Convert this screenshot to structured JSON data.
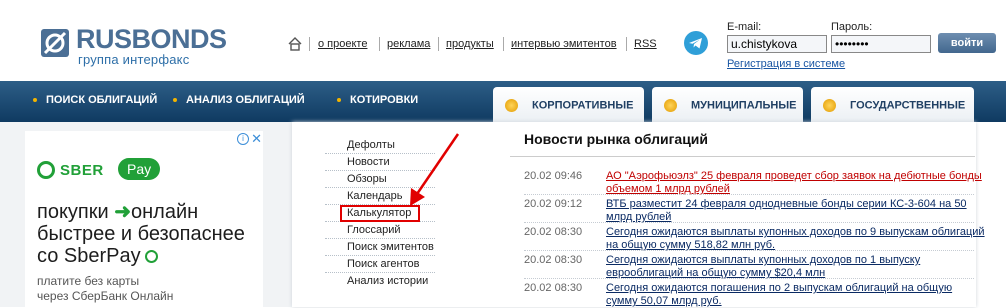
{
  "logo": {
    "brand": "RUSBONDS",
    "subtitle": "группа интерфакс"
  },
  "topnav": {
    "items": [
      "о проекте",
      "реклама",
      "продукты",
      "интервью эмитентов",
      "RSS"
    ]
  },
  "login": {
    "email_label": "E-mail:",
    "email_value": "u.chistykova",
    "password_label": "Пароль:",
    "password_value": "••••••••",
    "submit_label": "войти",
    "register_link": "Регистрация в системе"
  },
  "mainnav": {
    "items": [
      "ПОИСК ОБЛИГАЦИЙ",
      "АНАЛИЗ ОБЛИГАЦИЙ",
      "КОТИРОВКИ"
    ]
  },
  "tabs": [
    "КОРПОРАТИВНЫЕ",
    "МУНИЦИПАЛЬНЫЕ",
    "ГОСУДАРСТВЕННЫЕ"
  ],
  "ad": {
    "info_icon": "i",
    "close_icon": "✕",
    "brand": "SBER",
    "pay": "Pay",
    "headline_1": "покупки",
    "arrow": "➜",
    "headline_2": "онлайн",
    "headline_3": "быстрее и безопаснее",
    "headline_4": "со SberPay",
    "small_1": "платите без карты",
    "small_2": "через СберБанк Онлайн"
  },
  "submenu": {
    "items": [
      "Дефолты",
      "Новости",
      "Обзоры",
      "Календарь",
      "Калькулятор",
      "Глоссарий",
      "Поиск эмитентов",
      "Поиск агентов",
      "Анализ истории"
    ],
    "highlighted": "Калькулятор",
    "highlight_color": "#e10000"
  },
  "news": {
    "title": "Новости рынка облигаций",
    "items": [
      {
        "date": "20.02 09:46",
        "text": "АО \"Аэрофьюэлз\" 25 февраля проведет сбор заявок на дебютные бонды объемом 1 млрд рублей",
        "highlight": true
      },
      {
        "date": "20.02 09:12",
        "text": "ВТБ разместит 24 февраля однодневные бонды серии КС-3-604 на 50 млрд рублей"
      },
      {
        "date": "20.02 08:30",
        "text": "Сегодня ожидаются выплаты купонных доходов по 9 выпускам облигаций на общую сумму 518,82 млн руб."
      },
      {
        "date": "20.02 08:30",
        "text": "Сегодня ожидаются выплаты купонных доходов по 1 выпуску еврооблигаций на общую сумму $20,4 млн"
      },
      {
        "date": "20.02 08:30",
        "text": "Сегодня ожидаются погашения по 2 выпускам облигаций на общую сумму 50,07 млрд руб."
      }
    ]
  },
  "colors": {
    "nav_bg": "#0f3a61",
    "accent": "#f2b400",
    "link": "#0a2a63",
    "news_highlight": "#c00000",
    "sber_green": "#21a038"
  }
}
